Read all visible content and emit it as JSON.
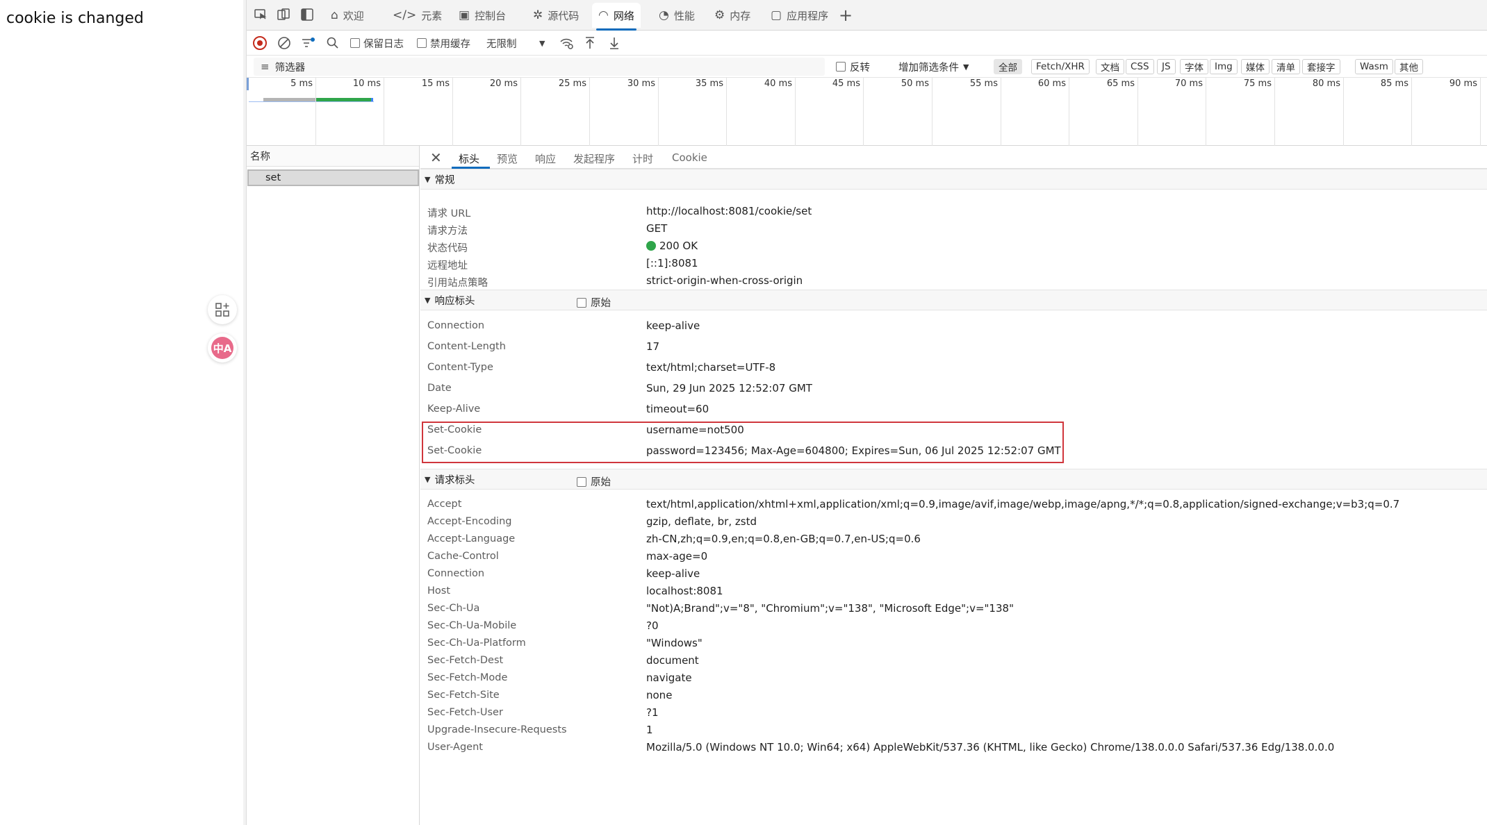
{
  "page": {
    "text": "cookie is changed"
  },
  "float_buttons": {
    "translate_glyph": "中A"
  },
  "tabs": [
    {
      "label": "欢迎",
      "icon": "home-icon"
    },
    {
      "label": "元素",
      "icon": "code-icon"
    },
    {
      "label": "控制台",
      "icon": "console-icon"
    },
    {
      "label": "源代码",
      "icon": "bug-icon"
    },
    {
      "label": "网络",
      "icon": "wifi-icon",
      "active": true
    },
    {
      "label": "性能",
      "icon": "performance-icon"
    },
    {
      "label": "内存",
      "icon": "memory-icon"
    },
    {
      "label": "应用程序",
      "icon": "application-icon"
    }
  ],
  "toolbar": {
    "preserve_log": "保留日志",
    "disable_cache": "禁用缓存",
    "throttling": "无限制"
  },
  "filter": {
    "placeholder": "筛选器",
    "invert": "反转",
    "more_filters": "增加筛选条件",
    "chips": [
      "全部",
      "Fetch/XHR",
      "文档",
      "CSS",
      "JS",
      "字体",
      "Img",
      "媒体",
      "清单",
      "套接字",
      "Wasm",
      "其他"
    ]
  },
  "timeline": {
    "ticks": [
      "5 ms",
      "10 ms",
      "15 ms",
      "20 ms",
      "25 ms",
      "30 ms",
      "35 ms",
      "40 ms",
      "45 ms",
      "50 ms",
      "55 ms",
      "60 ms",
      "65 ms",
      "70 ms",
      "75 ms",
      "80 ms",
      "85 ms",
      "90 ms"
    ]
  },
  "request_list": {
    "header": "名称",
    "items": [
      "set"
    ]
  },
  "detail_tabs": [
    "标头",
    "预览",
    "响应",
    "发起程序",
    "计时",
    "Cookie"
  ],
  "general": {
    "title": "常规",
    "rows": [
      {
        "k": "请求 URL",
        "v": "http://localhost:8081/cookie/set"
      },
      {
        "k": "请求方法",
        "v": "GET"
      },
      {
        "k": "状态代码",
        "v": "200 OK"
      },
      {
        "k": "远程地址",
        "v": "[::1]:8081"
      },
      {
        "k": "引用站点策略",
        "v": "strict-origin-when-cross-origin"
      }
    ]
  },
  "response_headers": {
    "title": "响应标头",
    "raw_label": "原始",
    "rows": [
      {
        "k": "Connection",
        "v": "keep-alive"
      },
      {
        "k": "Content-Length",
        "v": "17"
      },
      {
        "k": "Content-Type",
        "v": "text/html;charset=UTF-8"
      },
      {
        "k": "Date",
        "v": "Sun, 29 Jun 2025 12:52:07 GMT"
      },
      {
        "k": "Keep-Alive",
        "v": "timeout=60"
      },
      {
        "k": "Set-Cookie",
        "v": "username=not500"
      },
      {
        "k": "Set-Cookie",
        "v": "password=123456; Max-Age=604800; Expires=Sun, 06 Jul 2025 12:52:07 GMT"
      }
    ]
  },
  "request_headers": {
    "title": "请求标头",
    "raw_label": "原始",
    "rows": [
      {
        "k": "Accept",
        "v": "text/html,application/xhtml+xml,application/xml;q=0.9,image/avif,image/webp,image/apng,*/*;q=0.8,application/signed-exchange;v=b3;q=0.7"
      },
      {
        "k": "Accept-Encoding",
        "v": "gzip, deflate, br, zstd"
      },
      {
        "k": "Accept-Language",
        "v": "zh-CN,zh;q=0.9,en;q=0.8,en-GB;q=0.7,en-US;q=0.6"
      },
      {
        "k": "Cache-Control",
        "v": "max-age=0"
      },
      {
        "k": "Connection",
        "v": "keep-alive"
      },
      {
        "k": "Host",
        "v": "localhost:8081"
      },
      {
        "k": "Sec-Ch-Ua",
        "v": "\"Not)A;Brand\";v=\"8\", \"Chromium\";v=\"138\", \"Microsoft Edge\";v=\"138\""
      },
      {
        "k": "Sec-Ch-Ua-Mobile",
        "v": "?0"
      },
      {
        "k": "Sec-Ch-Ua-Platform",
        "v": "\"Windows\""
      },
      {
        "k": "Sec-Fetch-Dest",
        "v": "document"
      },
      {
        "k": "Sec-Fetch-Mode",
        "v": "navigate"
      },
      {
        "k": "Sec-Fetch-Site",
        "v": "none"
      },
      {
        "k": "Sec-Fetch-User",
        "v": "?1"
      },
      {
        "k": "Upgrade-Insecure-Requests",
        "v": "1"
      },
      {
        "k": "User-Agent",
        "v": "Mozilla/5.0 (Windows NT 10.0; Win64; x64) AppleWebKit/537.36 (KHTML, like Gecko) Chrome/138.0.0.0 Safari/537.36 Edg/138.0.0.0"
      }
    ]
  },
  "colors": {
    "accent": "#0f6cbd",
    "status_ok": "#2fa54a",
    "highlight": "#d0363c",
    "record": "#c42b1c"
  }
}
